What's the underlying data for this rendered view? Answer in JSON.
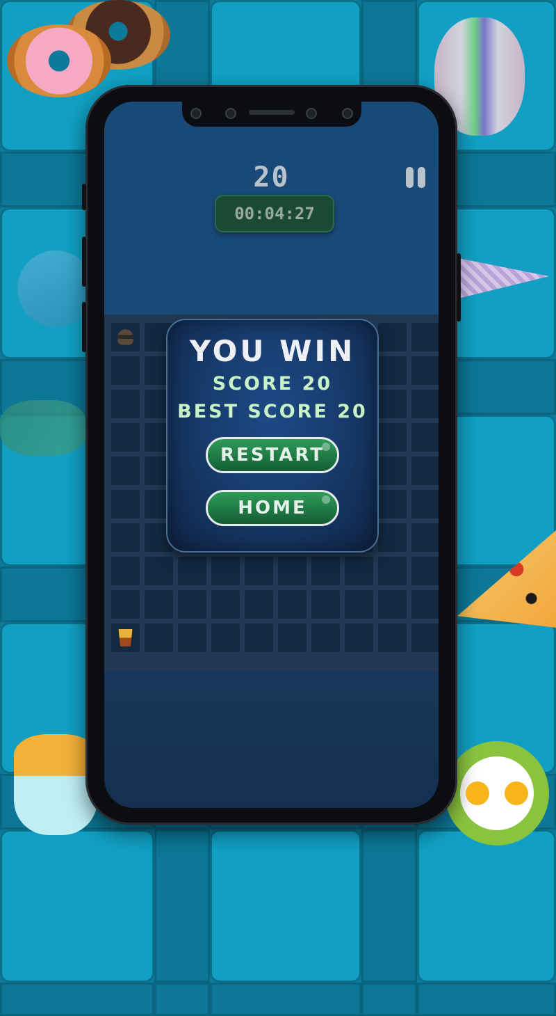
{
  "game": {
    "score": "20",
    "timer": "00:04:27"
  },
  "dialog": {
    "title": "YOU WIN",
    "score_line": "SCORE 20",
    "best_line": "BEST SCORE 20",
    "restart_label": "RESTART",
    "home_label": "HOME"
  },
  "board": {
    "rows": 10,
    "cols": 10,
    "tiles": [
      {
        "row": 0,
        "col": 0,
        "icon": "burger-icon"
      },
      {
        "row": 9,
        "col": 0,
        "icon": "fries-icon"
      }
    ]
  },
  "colors": {
    "background": "#0e7a99",
    "screen": "#1a4a78",
    "button_green": "#1f7a44",
    "text_green": "#c9f3c4"
  }
}
